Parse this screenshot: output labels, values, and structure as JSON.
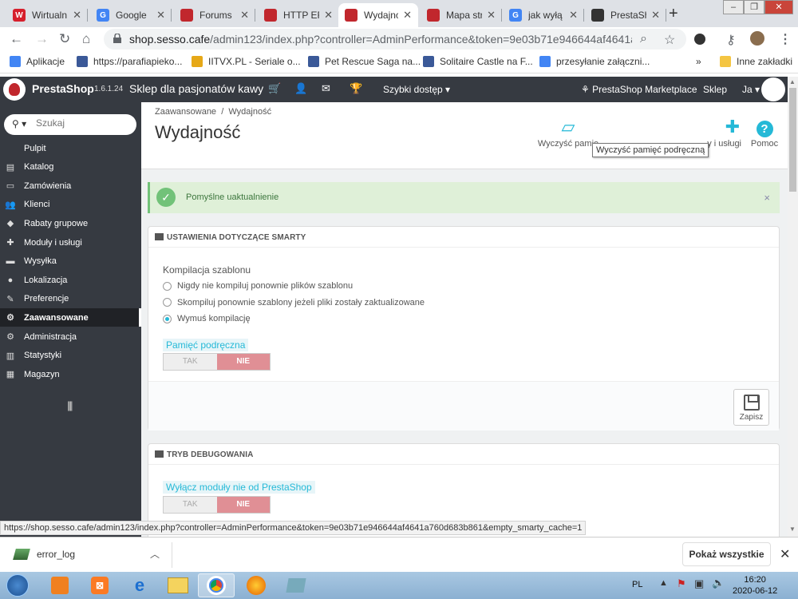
{
  "browser": {
    "tabs": [
      {
        "title": "Wirtualn",
        "icon": "wp-icon",
        "color": "#d61f2c",
        "glyph": "W"
      },
      {
        "title": "Google",
        "icon": "google-icon",
        "color": "#4285f4",
        "glyph": "G"
      },
      {
        "title": "Forums",
        "icon": "prestashop-icon",
        "color": "#c1272d",
        "glyph": ""
      },
      {
        "title": "HTTP ER",
        "icon": "prestashop-icon",
        "color": "#c1272d",
        "glyph": ""
      },
      {
        "title": "Wydajnc",
        "icon": "prestashop-icon",
        "color": "#c1272d",
        "glyph": "",
        "active": true
      },
      {
        "title": "Mapa str",
        "icon": "prestashop-icon",
        "color": "#c1272d",
        "glyph": ""
      },
      {
        "title": "jak wyłą",
        "icon": "google-icon",
        "color": "#4285f4",
        "glyph": "G"
      },
      {
        "title": "PrestaSh",
        "icon": "film-icon",
        "color": "#333333",
        "glyph": ""
      }
    ],
    "url_host": "shop.sesso.cafe",
    "url_path": "/admin123/index.php?controller=AdminPerformance&token=9e03b71e946644af4641a760...",
    "bookmarks": [
      {
        "label": "Aplikacje",
        "icon": "apps-icon",
        "color": "#4285f4"
      },
      {
        "label": "https://parafiapieko...",
        "icon": "site-icon",
        "color": "#3b5998"
      },
      {
        "label": "IITVX.PL - Seriale o...",
        "icon": "iitvx-icon",
        "color": "#e6a817"
      },
      {
        "label": "Pet Rescue Saga na...",
        "icon": "facebook-icon",
        "color": "#3b5998"
      },
      {
        "label": "Solitaire Castle na F...",
        "icon": "facebook-icon",
        "color": "#3b5998"
      },
      {
        "label": "przesyłanie załączni...",
        "icon": "google-icon",
        "color": "#4285f4"
      }
    ],
    "more_bookmarks": "»",
    "other_bookmarks": "Inne zakładki",
    "status_url": "https://shop.sesso.cafe/admin123/index.php?controller=AdminPerformance&token=9e03b71e946644af4641a760d683b861&empty_smarty_cache=1"
  },
  "header": {
    "brand": "PrestaShop",
    "version": "1.6.1.24",
    "shop_name": "Sklep dla pasjonatów kawy",
    "quick_access": "Szybki dostęp",
    "marketplace": "PrestaShop Marketplace",
    "shop_link": "Sklep",
    "user": "Ja"
  },
  "sidebar": {
    "search_placeholder": "Szukaj",
    "items": [
      {
        "label": "Pulpit",
        "icon": "dashboard-icon",
        "glyph": ""
      },
      {
        "label": "Katalog",
        "icon": "book-icon",
        "glyph": "▤"
      },
      {
        "label": "Zamówienia",
        "icon": "credit-card-icon",
        "glyph": "▭"
      },
      {
        "label": "Klienci",
        "icon": "users-icon",
        "glyph": "👥"
      },
      {
        "label": "Rabaty grupowe",
        "icon": "tag-icon",
        "glyph": "◆"
      },
      {
        "label": "Moduły i usługi",
        "icon": "puzzle-icon",
        "glyph": "✚"
      },
      {
        "label": "Wysyłka",
        "icon": "truck-icon",
        "glyph": "▬"
      },
      {
        "label": "Lokalizacja",
        "icon": "globe-icon",
        "glyph": "●"
      },
      {
        "label": "Preferencje",
        "icon": "wrench-icon",
        "glyph": "✎"
      },
      {
        "label": "Zaawansowane",
        "icon": "cogs-icon",
        "glyph": "⚙",
        "active": true
      },
      {
        "label": "Administracja",
        "icon": "cog-icon",
        "glyph": "⚙"
      },
      {
        "label": "Statystyki",
        "icon": "bar-chart-icon",
        "glyph": "▥"
      },
      {
        "label": "Magazyn",
        "icon": "archive-icon",
        "glyph": "▦"
      }
    ]
  },
  "page": {
    "breadcrumb_parent": "Zaawansowane",
    "breadcrumb_sep": "/",
    "breadcrumb_current": "Wydajność",
    "title": "Wydajność",
    "toolbar": {
      "clear_cache": "Wyczyść pamię",
      "modules": "y i usługi",
      "help": "Pomoc"
    },
    "tooltip": "Wyczyść pamięć podręczną",
    "alert": "Pomyślne uaktualnienie",
    "smarty_panel": {
      "heading": "USTAWIENIA DOTYCZĄCE SMARTY",
      "compile_label": "Kompilacja szablonu",
      "options": [
        {
          "label": "Nigdy nie kompiluj ponownie plików szablonu",
          "checked": false
        },
        {
          "label": "Skompiluj ponownie szablony jeżeli pliki zostały zaktualizowane",
          "checked": false
        },
        {
          "label": "Wymuś kompilację",
          "checked": true
        }
      ],
      "cache_label": "Pamięć podręczna",
      "yes": "TAK",
      "no": "NIE",
      "save": "Zapisz"
    },
    "debug_panel": {
      "heading": "TRYB DEBUGOWANIA",
      "modules_label": "Wyłącz moduły nie od PrestaShop",
      "yes": "TAK",
      "no": "NIE"
    }
  },
  "downloads": {
    "file": "error_log",
    "show_all": "Pokaż wszystkie"
  },
  "taskbar": {
    "lang": "PL",
    "time": "16:20",
    "date": "2020-06-12"
  }
}
